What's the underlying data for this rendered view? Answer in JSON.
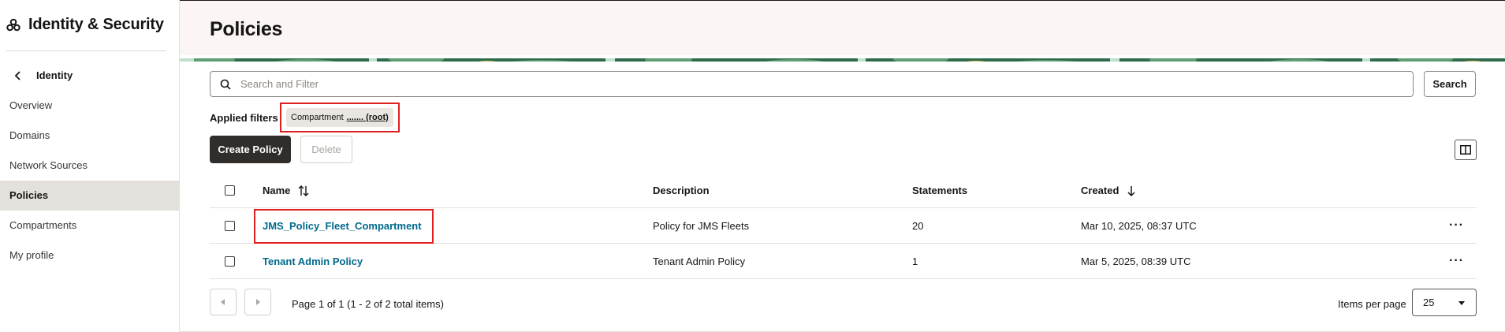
{
  "sidebar": {
    "title": "Identity & Security",
    "back_label": "Identity",
    "items": [
      {
        "label": "Overview",
        "active": false
      },
      {
        "label": "Domains",
        "active": false
      },
      {
        "label": "Network Sources",
        "active": false
      },
      {
        "label": "Policies",
        "active": true
      },
      {
        "label": "Compartments",
        "active": false
      },
      {
        "label": "My profile",
        "active": false
      }
    ]
  },
  "header": {
    "title": "Policies"
  },
  "search": {
    "placeholder": "Search and Filter",
    "value": "",
    "button_label": "Search"
  },
  "filters": {
    "label": "Applied filters",
    "chip_key": "Compartment",
    "chip_value": "....... (root)"
  },
  "actions": {
    "create_label": "Create Policy",
    "delete_label": "Delete"
  },
  "table": {
    "columns": {
      "name": "Name",
      "description": "Description",
      "statements": "Statements",
      "created": "Created"
    },
    "rows": [
      {
        "name": "JMS_Policy_Fleet_Compartment",
        "description": "Policy for JMS Fleets",
        "statements": "20",
        "created": "Mar 10, 2025, 08:37 UTC"
      },
      {
        "name": "Tenant Admin Policy",
        "description": "Tenant Admin Policy",
        "statements": "1",
        "created": "Mar 5, 2025, 08:39 UTC"
      }
    ]
  },
  "pagination": {
    "text": "Page 1 of 1 (1 - 2 of 2 total items)",
    "items_per_page_label": "Items per page",
    "items_per_page_value": "25"
  },
  "colors": {
    "link": "#00688c",
    "primary_button": "#312d2a",
    "highlight": "#e02020",
    "active_nav": "#e4e1dd"
  },
  "icons": [
    "cluster-icon",
    "chevron-left-icon",
    "search-icon",
    "sort-icon",
    "arrow-down-icon",
    "columns-icon",
    "more-icon",
    "caret-left-icon",
    "caret-right-icon",
    "caret-down-icon"
  ]
}
